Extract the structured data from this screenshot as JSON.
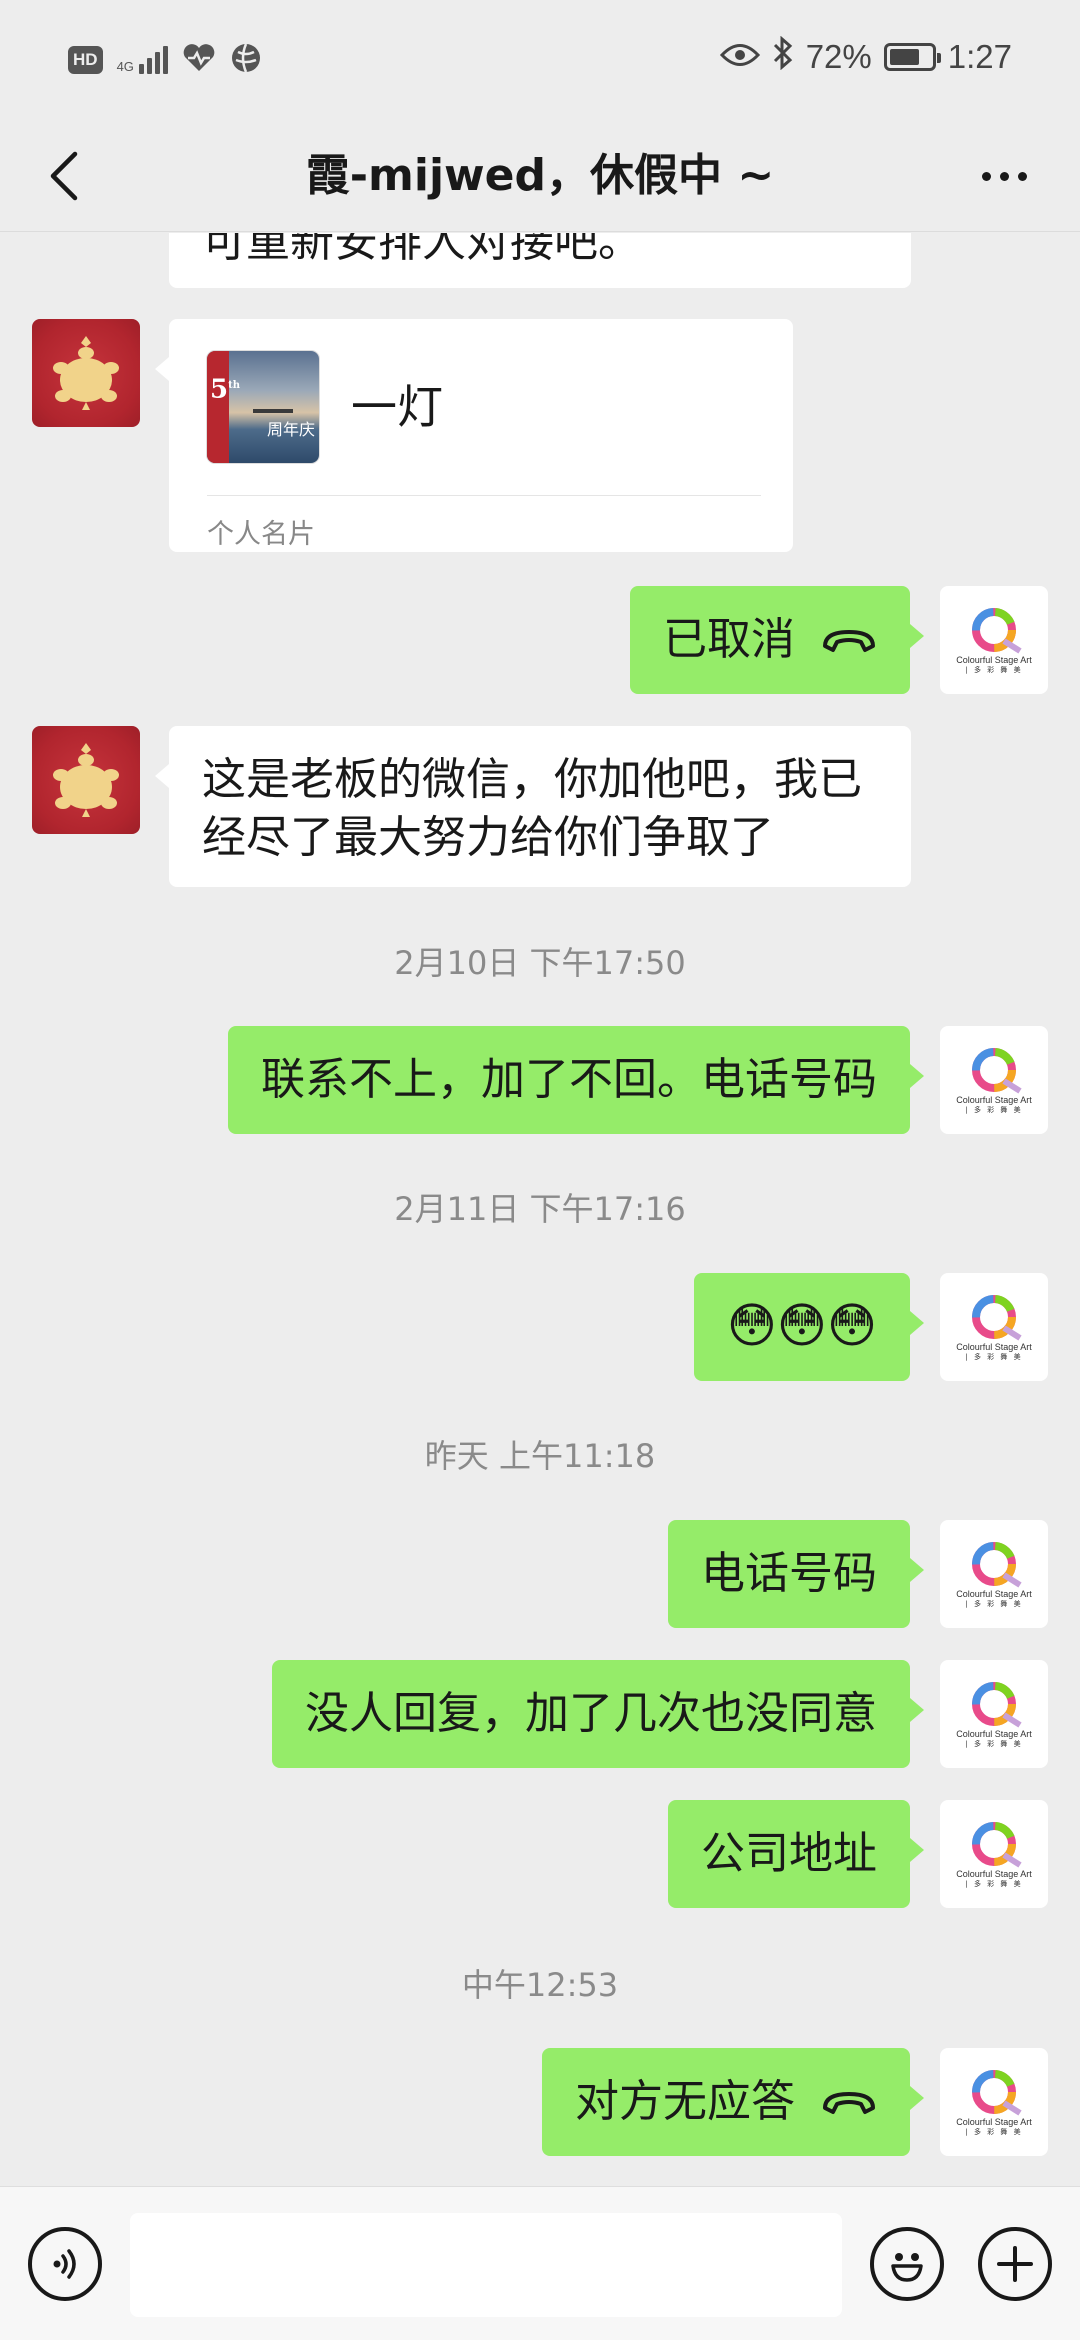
{
  "status_bar": {
    "hd_label": "HD",
    "network_label": "4G",
    "battery_percent": "72%",
    "battery_level": 0.72,
    "time": "1:27",
    "icons": [
      "hd-icon",
      "signal-icon",
      "health-icon",
      "vpn-icon",
      "eye-icon",
      "bluetooth-icon",
      "battery-icon"
    ]
  },
  "header": {
    "title": "霞-mijwed，休假中 ~",
    "back_icon": "back-arrow-icon",
    "more_icon": "more-icon"
  },
  "messages": {
    "m0_text": "可重新安排人对接吧。",
    "card": {
      "name": "一灯",
      "badge": "5",
      "badge_suffix": "th",
      "thumb_caption": "周年庆",
      "footer": "个人名片"
    },
    "m1_text": "已取消",
    "m2_text": "这是老板的微信，你加他吧，我已经尽了最大努力给你们争取了",
    "ts1": "2月10日 下午17:50",
    "m3_text": "联系不上，加了不回。电话号码",
    "ts2": "2月11日 下午17:16",
    "m4_emoji": "😳😳😳",
    "ts3": "昨天 上午11:18",
    "m5_text": "电话号码",
    "m6_text": "没人回复，加了几次也没同意",
    "m7_text": "公司地址",
    "ts4": "中午12:53",
    "m8_text": "对方无应答"
  },
  "self_avatar": {
    "line1": "Colourful Stage Art",
    "line2": "| 多 彩 舞 美"
  },
  "input_bar": {
    "voice_icon": "voice-icon",
    "text_value": "",
    "emoji_icon": "emoji-icon",
    "plus_icon": "plus-icon"
  },
  "colors": {
    "background": "#ededed",
    "bubble_self": "#95ec69",
    "bubble_other": "#ffffff",
    "avatar_other": "#b1252e"
  }
}
